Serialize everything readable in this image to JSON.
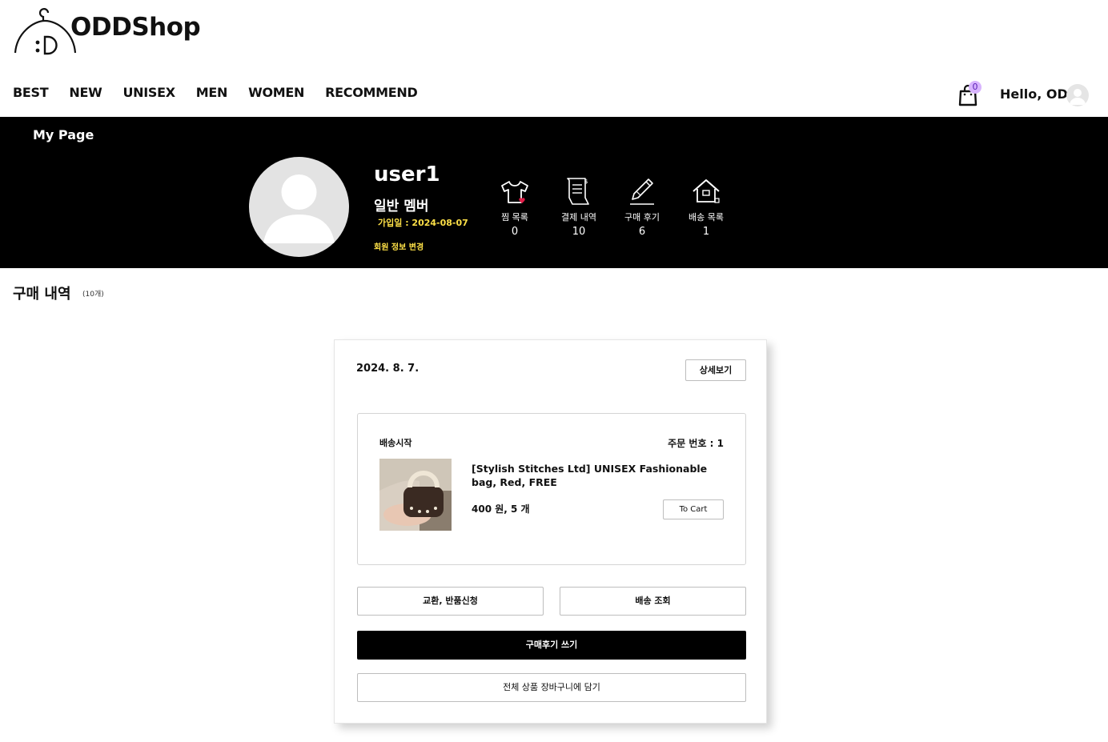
{
  "brand": {
    "name": "ODDShop",
    "icon": "hanger-smiley-logo"
  },
  "nav": [
    "BEST",
    "NEW",
    "UNISEX",
    "MEN",
    "WOMEN",
    "RECOMMEND"
  ],
  "header": {
    "cart_count": "0",
    "greeting": "Hello, ODD!",
    "cart_icon": "shopping-bag-icon",
    "avatar_icon": "user-avatar-icon"
  },
  "mypage": {
    "title": "My Page",
    "username": "user1",
    "grade": "일반 멤버",
    "joined": "가입일 : 2024-08-07",
    "edit_link": "회원 정보 변경",
    "stats": [
      {
        "label": "찜 목록",
        "value": "0",
        "icon": "tshirt-heart-icon"
      },
      {
        "label": "결제 내역",
        "value": "10",
        "icon": "receipt-icon"
      },
      {
        "label": "구매 후기",
        "value": "6",
        "icon": "pencil-icon"
      },
      {
        "label": "배송 목록",
        "value": "1",
        "icon": "house-icon"
      }
    ]
  },
  "purchases": {
    "title": "구매 내역",
    "count": "(10개)",
    "order": {
      "date": "2024. 8. 7.",
      "detail_label": "상세보기",
      "status": "배송시작",
      "order_no": "주문 번호 : 1",
      "product_name": "[Stylish Stitches Ltd] UNISEX Fashionable bag, Red, FREE",
      "price_qty": "400 원, 5 개",
      "to_cart_label": "To Cart",
      "exchange_label": "교환, 반품신청",
      "track_label": "배송 조회",
      "review_label": "구매후기 쓰기",
      "all_cart_label": "전체 상품 장바구니에 담기"
    }
  },
  "colors": {
    "banner_bg": "#000000",
    "accent_yellow": "#fde047",
    "badge": "#d8b4fe",
    "heart": "#e11d48"
  }
}
